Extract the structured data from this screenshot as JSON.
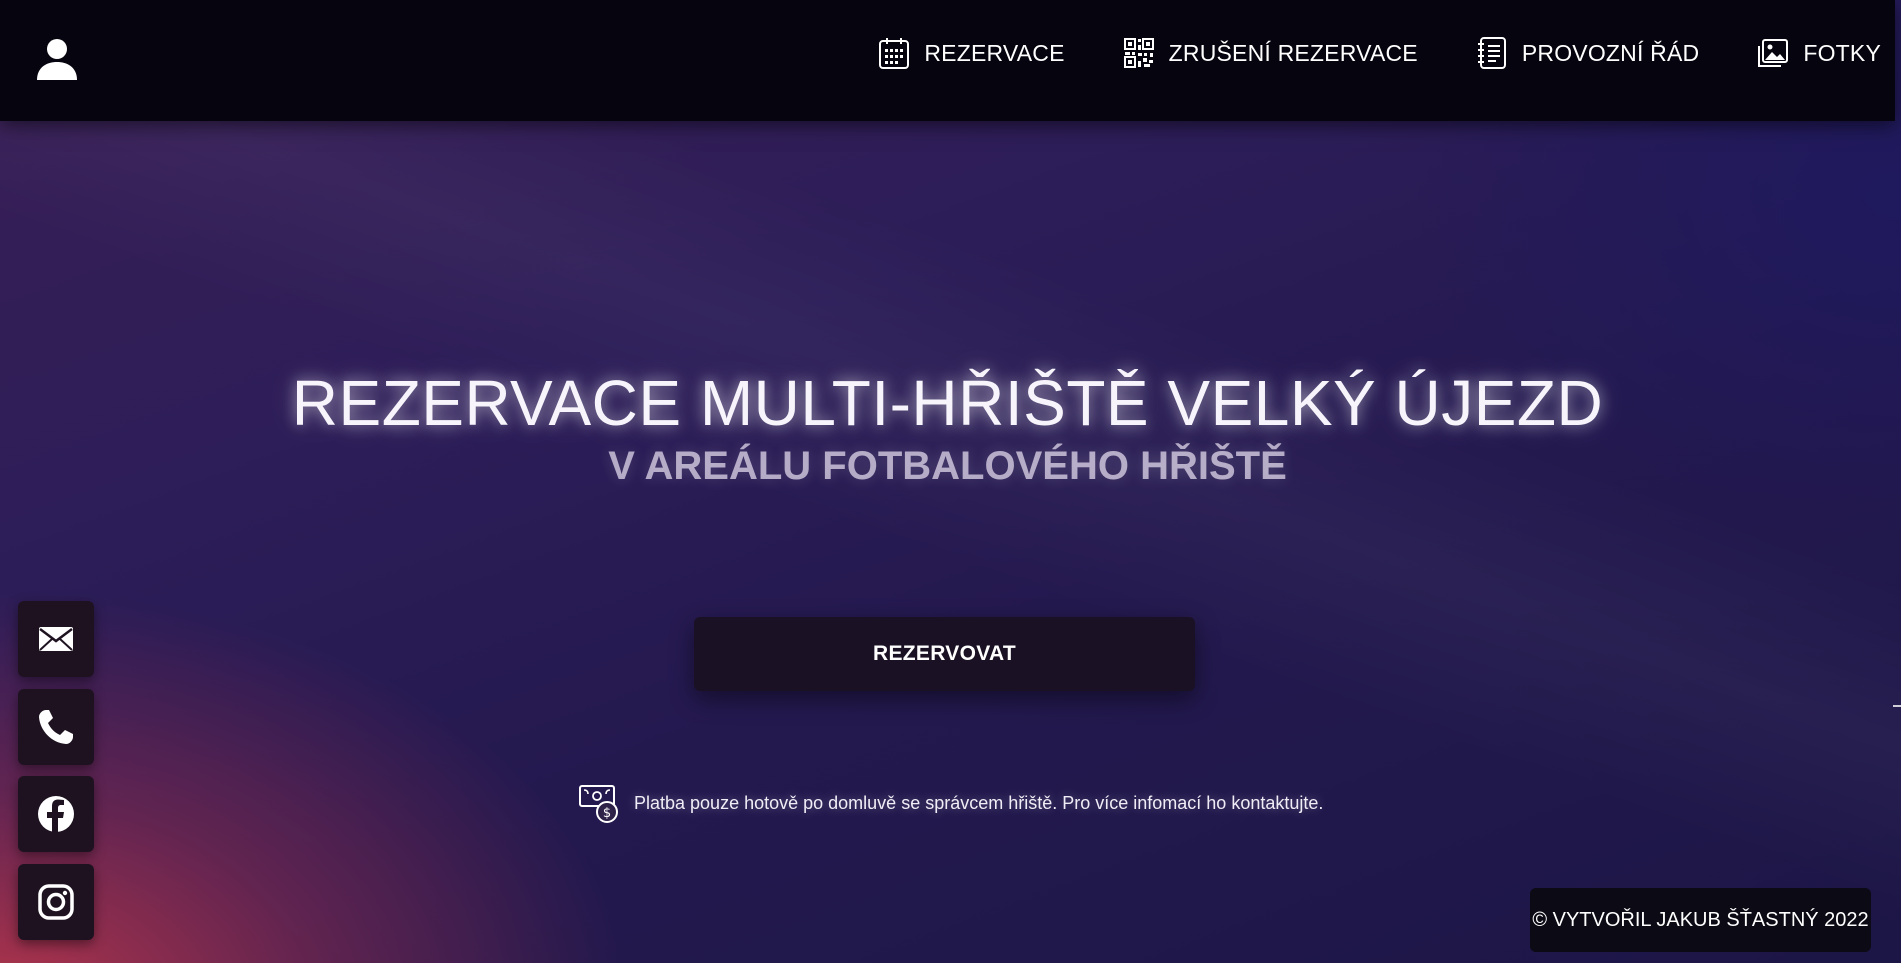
{
  "nav": {
    "user_icon": "user-icon",
    "items": [
      {
        "label": "REZERVACE",
        "icon": "calendar-icon"
      },
      {
        "label": "ZRUŠENÍ REZERVACE",
        "icon": "qr-code-icon"
      },
      {
        "label": "PROVOZNÍ ŘÁD",
        "icon": "notebook-icon"
      },
      {
        "label": "FOTKY",
        "icon": "photo-icon"
      }
    ]
  },
  "hero": {
    "title": "REZERVACE MULTI-HŘIŠTĚ VELKÝ ÚJEZD",
    "subtitle": "V AREÁLU FOTBALOVÉHO HŘIŠTĚ",
    "button_label": "REZERVOVAT"
  },
  "payment": {
    "icon": "cash-icon",
    "text": "Platba pouze hotově po domluvě se správcem hřiště. Pro více infomací ho kontaktujte."
  },
  "social": [
    "email-icon",
    "phone-icon",
    "facebook-icon",
    "instagram-icon"
  ],
  "footer": {
    "credit": "© VYTVOŘIL JAKUB ŠŤASTNÝ 2022"
  },
  "colors": {
    "topbar": "#06050f",
    "button": "#1a1224",
    "accent_glow": "#be374b"
  }
}
